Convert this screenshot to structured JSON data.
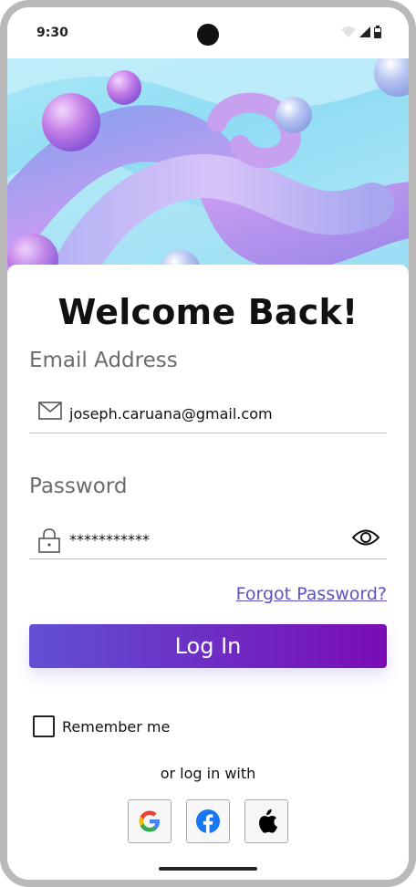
{
  "status_bar": {
    "time": "9:30",
    "icons": [
      "wifi-icon",
      "signal-icon",
      "battery-icon"
    ]
  },
  "login": {
    "title": "Welcome Back!",
    "email": {
      "label": "Email Address",
      "value": "joseph.caruana@gmail.com",
      "icon": "mail-icon"
    },
    "password": {
      "label": "Password",
      "value": "***********",
      "icon": "lock-icon",
      "toggle_icon": "eye-icon"
    },
    "forgot_password": "Forgot Password?",
    "login_button": "Log In",
    "remember_me": {
      "label": "Remember me",
      "checked": false
    },
    "social_divider": "or log in with",
    "social_providers": [
      "google-icon",
      "facebook-icon",
      "apple-icon"
    ]
  },
  "colors": {
    "accent_start": "#6150d4",
    "accent_end": "#7a0cb5",
    "link": "#5a52c5"
  }
}
